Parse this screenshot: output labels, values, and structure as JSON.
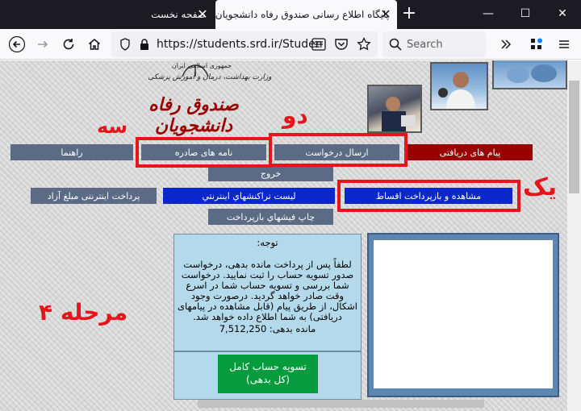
{
  "browser": {
    "tabs": [
      {
        "title": "صفحه نخست",
        "active": false
      },
      {
        "title": "پایگاه اطلاع رسانی صندوق رفاه دانشجویان",
        "active": true
      }
    ],
    "new_tab_label": "+",
    "window_controls": {
      "minimize": "—",
      "maximize": "☐",
      "close": "✕"
    },
    "url": "https://students.srd.ir/Studen",
    "search_placeholder": "Search"
  },
  "header": {
    "ministry_line1": "جمهوری اسلامی ایران",
    "ministry_line2": "وزارت بهداشت، درمان و آموزش پزشکی",
    "title": "صندوق رفاه دانشجویان"
  },
  "nav": {
    "row1": {
      "received_messages": "پیام های دریافتی",
      "send_request": "ارسال درخواست",
      "issued_letters": "نامه های صادره",
      "guide": "راهنما"
    },
    "row2": {
      "logout": "خروج"
    },
    "row3": {
      "view_repay_installments": "مشاهده و بازپرداخت اقساط",
      "online_transactions_list": "ليست تراكنشهاي اينترنتي",
      "online_payment_free_amount": "پرداخت اینترنتی مبلغ آزاد"
    },
    "row4": {
      "print_repayment_receipts": "چاپ فيشهاي بازپرداخت"
    }
  },
  "annotations": {
    "one": "یک",
    "two": "دو",
    "three": "سه",
    "step4": "مرحله ۴"
  },
  "notice": {
    "heading": "توجه:",
    "body": "لطفاً پس از پرداخت مانده بدهی، درخواست صدور تسویه حساب را ثبت نمایید. درخواست شما بررسی و تسویه حساب شما در اسرع وقت صادر خواهد گردید. درصورت وجود اشکال، از طریق پیام (قابل مشاهده در پیامهای دریافتی) به شما اطلاع داده خواهد شد.",
    "balance_label": "مانده بدهی:",
    "balance_value": "7,512,250"
  },
  "settle_button": {
    "line1": "تسویه حساب کامل",
    "line2": "(کل بدهی)"
  },
  "colors": {
    "nav_gray": "#5b6b86",
    "nav_red": "#9a0000",
    "nav_blue": "#0a27cc",
    "annotation_red": "#e8141c",
    "settle_green": "#069b3c",
    "notice_bg": "#b4d9ea"
  }
}
